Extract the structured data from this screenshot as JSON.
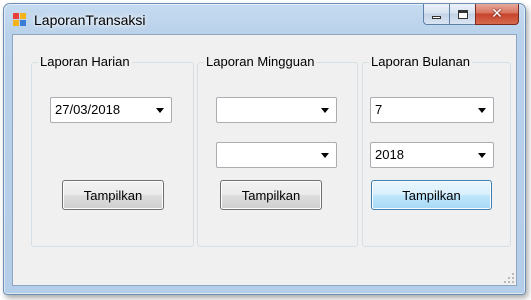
{
  "window": {
    "title": "LaporanTransaksi",
    "icon": "app-form-icon",
    "controls": {
      "minimize": "minimize-icon",
      "maximize": "maximize-icon",
      "close": "✕"
    }
  },
  "groups": [
    {
      "title": "Laporan Harian",
      "combos": [
        {
          "value": "27/03/2018"
        }
      ],
      "button": "Tampilkan"
    },
    {
      "title": "Laporan Mingguan",
      "combos": [
        {
          "value": ""
        },
        {
          "value": ""
        }
      ],
      "button": "Tampilkan"
    },
    {
      "title": "Laporan Bulanan",
      "combos": [
        {
          "value": "7"
        },
        {
          "value": "2018"
        }
      ],
      "button": "Tampilkan"
    }
  ],
  "colors": {
    "window_frame": "#b9d1ea",
    "client_bg": "#f0f0f0",
    "close_button": "#c7432b",
    "focus_border": "#3c7fb1"
  }
}
